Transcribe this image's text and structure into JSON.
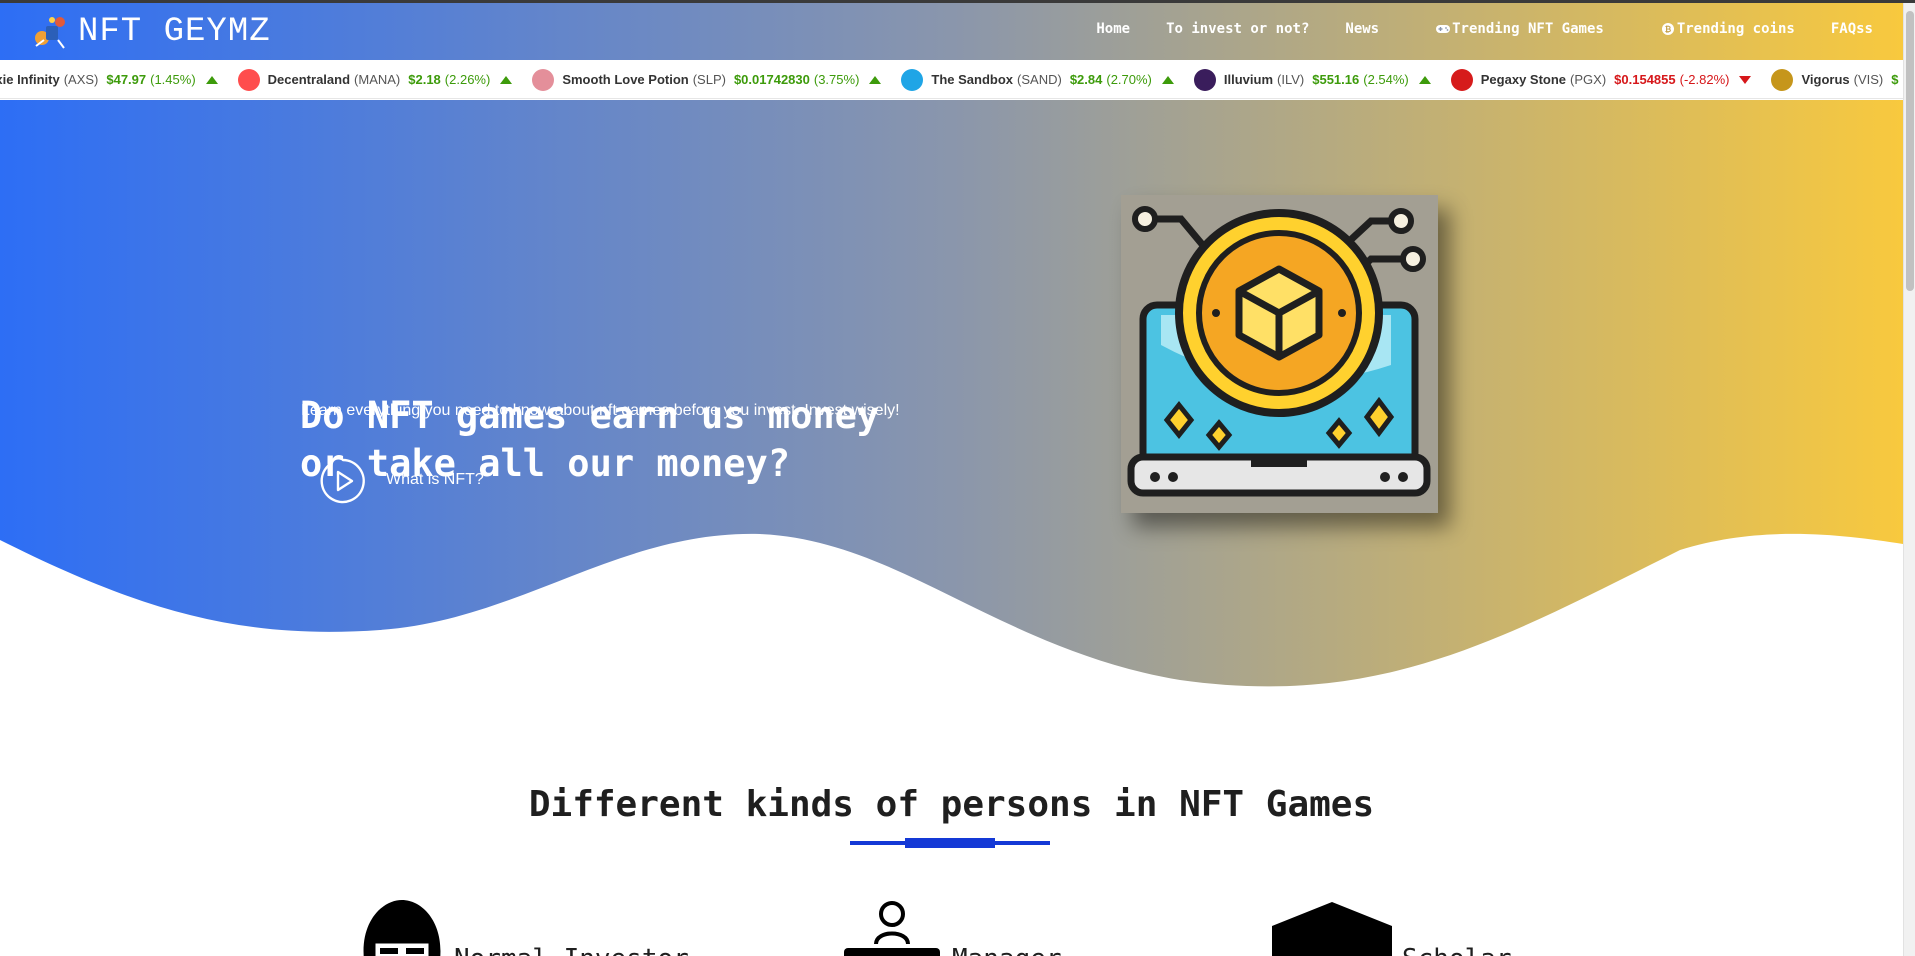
{
  "brand": {
    "name": "NFT GEYMZ"
  },
  "nav": {
    "items": [
      {
        "label": "Home"
      },
      {
        "label": "To invest or not?"
      },
      {
        "label": "News"
      },
      {
        "label": "Trending NFT Games",
        "icon": "gamepad-icon"
      },
      {
        "label": "Trending coins",
        "icon": "coin-icon"
      },
      {
        "label": "FAQss"
      }
    ]
  },
  "ticker": {
    "coins": [
      {
        "name": "Axie Infinity",
        "symbol": "(AXS)",
        "price": "$47.97",
        "change": "(1.45%)",
        "direction": "up",
        "color": "#3b7de0"
      },
      {
        "name": "Decentraland",
        "symbol": "(MANA)",
        "price": "$2.18",
        "change": "(2.26%)",
        "direction": "up",
        "color": "#ff4d4d"
      },
      {
        "name": "Smooth Love Potion",
        "symbol": "(SLP)",
        "price": "$0.01742830",
        "change": "(3.75%)",
        "direction": "up",
        "color": "#e48f9a"
      },
      {
        "name": "The Sandbox",
        "symbol": "(SAND)",
        "price": "$2.84",
        "change": "(2.70%)",
        "direction": "up",
        "color": "#1fa5e6"
      },
      {
        "name": "Illuvium",
        "symbol": "(ILV)",
        "price": "$551.16",
        "change": "(2.54%)",
        "direction": "up",
        "color": "#3a1d5c"
      },
      {
        "name": "Pegaxy Stone",
        "symbol": "(PGX)",
        "price": "$0.154855",
        "change": "(-2.82%)",
        "direction": "down",
        "color": "#d61b1b"
      },
      {
        "name": "Vigorus",
        "symbol": "(VIS)",
        "price": "$",
        "change": "",
        "direction": "up",
        "color": "#c6961b"
      }
    ]
  },
  "hero": {
    "title_line1": "Do NFT games earn us money",
    "title_line2": "or take all our money?",
    "subtitle": "Learn everything you need to know about nft games before you invest. Invest wisely!",
    "cta_label": "What is NFT?",
    "cta_icon": "play-circle-icon",
    "image_icon": "crypto-laptop-icon"
  },
  "section": {
    "title": "Different kinds of persons in NFT Games",
    "personas": [
      {
        "label": "Normal Investor",
        "icon": "investor-face-icon"
      },
      {
        "label": "Manager",
        "icon": "manager-icon"
      },
      {
        "label": "Scholar",
        "icon": "scholar-cap-icon"
      }
    ]
  },
  "colors": {
    "gradient_start": "#2d6ef5",
    "gradient_mid": "#8a96ac",
    "gradient_end": "#f8c93e",
    "accent_underline": "#1439d6",
    "price_up": "#3d9b0b",
    "price_down": "#d6171a"
  }
}
